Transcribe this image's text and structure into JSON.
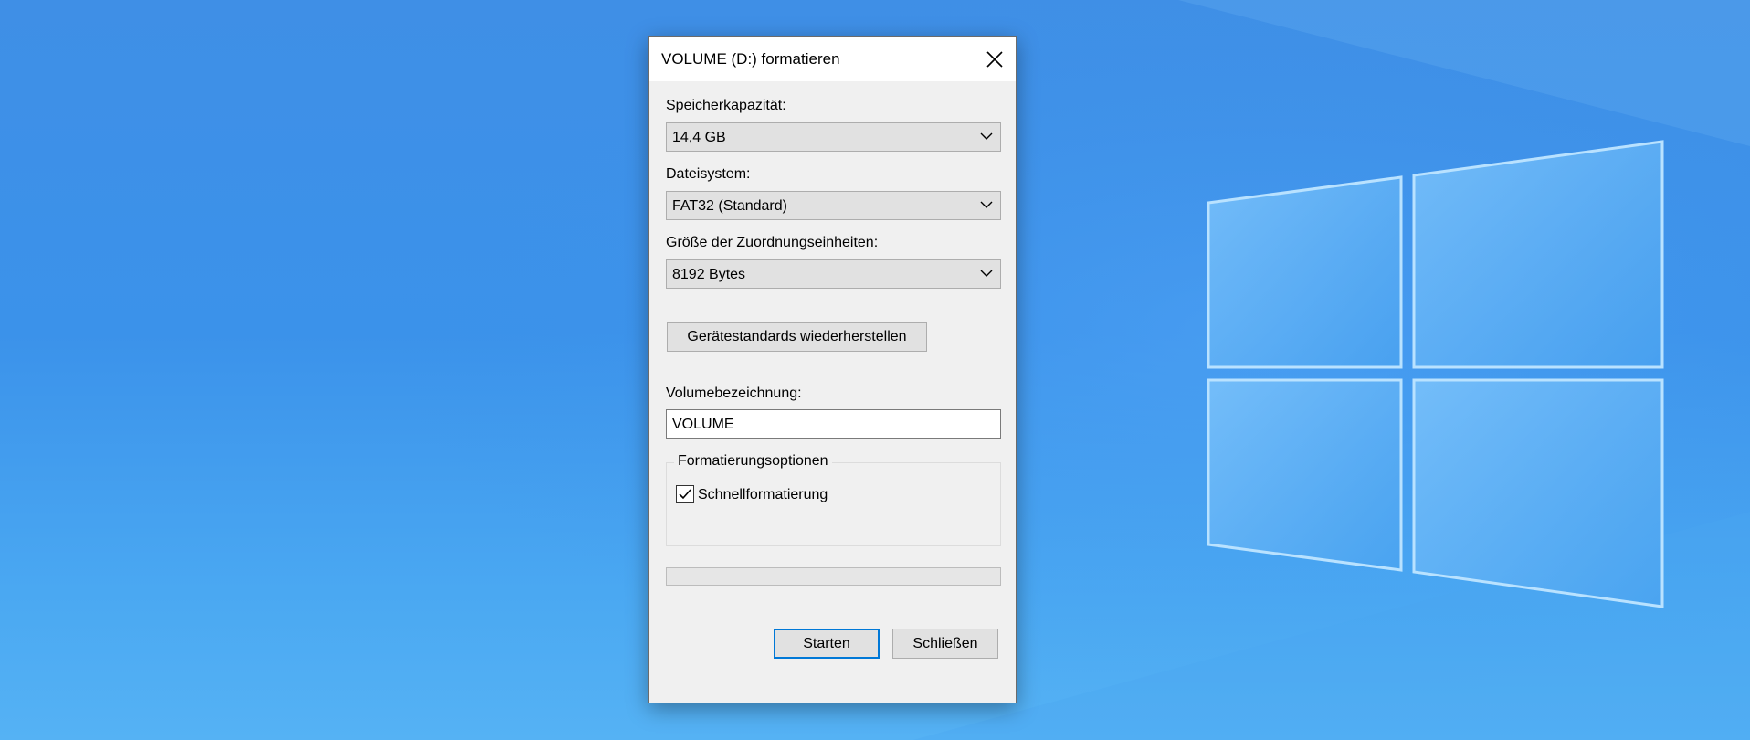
{
  "dialog": {
    "title": "VOLUME (D:) formatieren",
    "capacity": {
      "label": "Speicherkapazität:",
      "value": "14,4 GB"
    },
    "filesystem": {
      "label": "Dateisystem:",
      "value": "FAT32 (Standard)"
    },
    "allocation": {
      "label": "Größe der Zuordnungseinheiten:",
      "value": "8192 Bytes"
    },
    "restore_defaults_label": "Gerätestandards wiederherstellen",
    "volume_label": {
      "label": "Volumebezeichnung:",
      "value": "VOLUME"
    },
    "format_options": {
      "legend": "Formatierungsoptionen",
      "quick_format": {
        "label": "Schnellformatierung",
        "checked": true
      }
    },
    "progress": 0,
    "start_label": "Starten",
    "close_label": "Schließen"
  },
  "icons": {
    "close": "close-icon",
    "dropdown": "chevron-down-icon",
    "check": "checkmark-icon"
  },
  "colors": {
    "accent": "#0078d7",
    "dialog_bg": "#f0f0f0",
    "progress_fill": "#06b025"
  }
}
